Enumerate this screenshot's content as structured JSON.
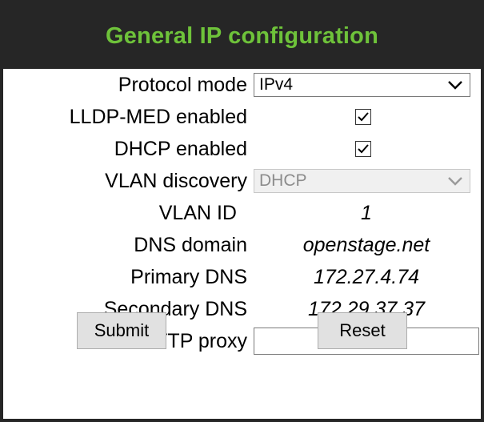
{
  "header": {
    "title": "General IP configuration"
  },
  "colors": {
    "title_green": "#6ec23a",
    "frame": "#262626"
  },
  "fields": [
    {
      "label": "Protocol mode",
      "type": "select",
      "value": "IPv4",
      "icon": "chevron-down-icon"
    },
    {
      "label": "LLDP-MED enabled",
      "type": "checkbox",
      "checked": true
    },
    {
      "label": "DHCP enabled",
      "type": "checkbox",
      "checked": true
    },
    {
      "label": "VLAN discovery",
      "type": "select",
      "value": "DHCP",
      "disabled": true,
      "icon": "chevron-down-icon"
    },
    {
      "label": "VLAN ID",
      "type": "text",
      "value": "1"
    },
    {
      "label": "DNS domain",
      "type": "text",
      "value": "openstage.net"
    },
    {
      "label": "Primary DNS",
      "type": "text",
      "value": "172.27.4.74"
    },
    {
      "label": "Secondary DNS",
      "type": "text",
      "value": "172.29.37.37"
    },
    {
      "label": "HTTP proxy",
      "type": "input",
      "value": ""
    }
  ],
  "buttons": {
    "submit_label": "Submit",
    "reset_label": "Reset"
  }
}
